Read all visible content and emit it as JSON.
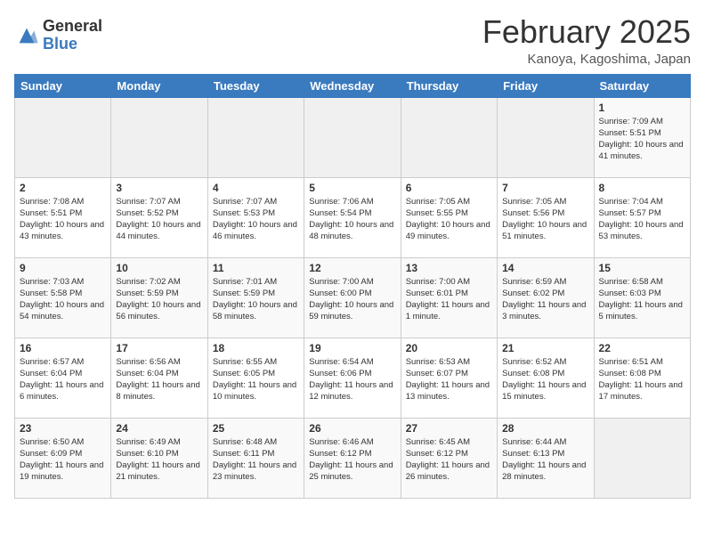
{
  "header": {
    "logo_general": "General",
    "logo_blue": "Blue",
    "month_title": "February 2025",
    "location": "Kanoya, Kagoshima, Japan"
  },
  "weekdays": [
    "Sunday",
    "Monday",
    "Tuesday",
    "Wednesday",
    "Thursday",
    "Friday",
    "Saturday"
  ],
  "weeks": [
    [
      {
        "day": "",
        "info": ""
      },
      {
        "day": "",
        "info": ""
      },
      {
        "day": "",
        "info": ""
      },
      {
        "day": "",
        "info": ""
      },
      {
        "day": "",
        "info": ""
      },
      {
        "day": "",
        "info": ""
      },
      {
        "day": "1",
        "info": "Sunrise: 7:09 AM\nSunset: 5:51 PM\nDaylight: 10 hours and 41 minutes."
      }
    ],
    [
      {
        "day": "2",
        "info": "Sunrise: 7:08 AM\nSunset: 5:51 PM\nDaylight: 10 hours and 43 minutes."
      },
      {
        "day": "3",
        "info": "Sunrise: 7:07 AM\nSunset: 5:52 PM\nDaylight: 10 hours and 44 minutes."
      },
      {
        "day": "4",
        "info": "Sunrise: 7:07 AM\nSunset: 5:53 PM\nDaylight: 10 hours and 46 minutes."
      },
      {
        "day": "5",
        "info": "Sunrise: 7:06 AM\nSunset: 5:54 PM\nDaylight: 10 hours and 48 minutes."
      },
      {
        "day": "6",
        "info": "Sunrise: 7:05 AM\nSunset: 5:55 PM\nDaylight: 10 hours and 49 minutes."
      },
      {
        "day": "7",
        "info": "Sunrise: 7:05 AM\nSunset: 5:56 PM\nDaylight: 10 hours and 51 minutes."
      },
      {
        "day": "8",
        "info": "Sunrise: 7:04 AM\nSunset: 5:57 PM\nDaylight: 10 hours and 53 minutes."
      }
    ],
    [
      {
        "day": "9",
        "info": "Sunrise: 7:03 AM\nSunset: 5:58 PM\nDaylight: 10 hours and 54 minutes."
      },
      {
        "day": "10",
        "info": "Sunrise: 7:02 AM\nSunset: 5:59 PM\nDaylight: 10 hours and 56 minutes."
      },
      {
        "day": "11",
        "info": "Sunrise: 7:01 AM\nSunset: 5:59 PM\nDaylight: 10 hours and 58 minutes."
      },
      {
        "day": "12",
        "info": "Sunrise: 7:00 AM\nSunset: 6:00 PM\nDaylight: 10 hours and 59 minutes."
      },
      {
        "day": "13",
        "info": "Sunrise: 7:00 AM\nSunset: 6:01 PM\nDaylight: 11 hours and 1 minute."
      },
      {
        "day": "14",
        "info": "Sunrise: 6:59 AM\nSunset: 6:02 PM\nDaylight: 11 hours and 3 minutes."
      },
      {
        "day": "15",
        "info": "Sunrise: 6:58 AM\nSunset: 6:03 PM\nDaylight: 11 hours and 5 minutes."
      }
    ],
    [
      {
        "day": "16",
        "info": "Sunrise: 6:57 AM\nSunset: 6:04 PM\nDaylight: 11 hours and 6 minutes."
      },
      {
        "day": "17",
        "info": "Sunrise: 6:56 AM\nSunset: 6:04 PM\nDaylight: 11 hours and 8 minutes."
      },
      {
        "day": "18",
        "info": "Sunrise: 6:55 AM\nSunset: 6:05 PM\nDaylight: 11 hours and 10 minutes."
      },
      {
        "day": "19",
        "info": "Sunrise: 6:54 AM\nSunset: 6:06 PM\nDaylight: 11 hours and 12 minutes."
      },
      {
        "day": "20",
        "info": "Sunrise: 6:53 AM\nSunset: 6:07 PM\nDaylight: 11 hours and 13 minutes."
      },
      {
        "day": "21",
        "info": "Sunrise: 6:52 AM\nSunset: 6:08 PM\nDaylight: 11 hours and 15 minutes."
      },
      {
        "day": "22",
        "info": "Sunrise: 6:51 AM\nSunset: 6:08 PM\nDaylight: 11 hours and 17 minutes."
      }
    ],
    [
      {
        "day": "23",
        "info": "Sunrise: 6:50 AM\nSunset: 6:09 PM\nDaylight: 11 hours and 19 minutes."
      },
      {
        "day": "24",
        "info": "Sunrise: 6:49 AM\nSunset: 6:10 PM\nDaylight: 11 hours and 21 minutes."
      },
      {
        "day": "25",
        "info": "Sunrise: 6:48 AM\nSunset: 6:11 PM\nDaylight: 11 hours and 23 minutes."
      },
      {
        "day": "26",
        "info": "Sunrise: 6:46 AM\nSunset: 6:12 PM\nDaylight: 11 hours and 25 minutes."
      },
      {
        "day": "27",
        "info": "Sunrise: 6:45 AM\nSunset: 6:12 PM\nDaylight: 11 hours and 26 minutes."
      },
      {
        "day": "28",
        "info": "Sunrise: 6:44 AM\nSunset: 6:13 PM\nDaylight: 11 hours and 28 minutes."
      },
      {
        "day": "",
        "info": ""
      }
    ]
  ]
}
